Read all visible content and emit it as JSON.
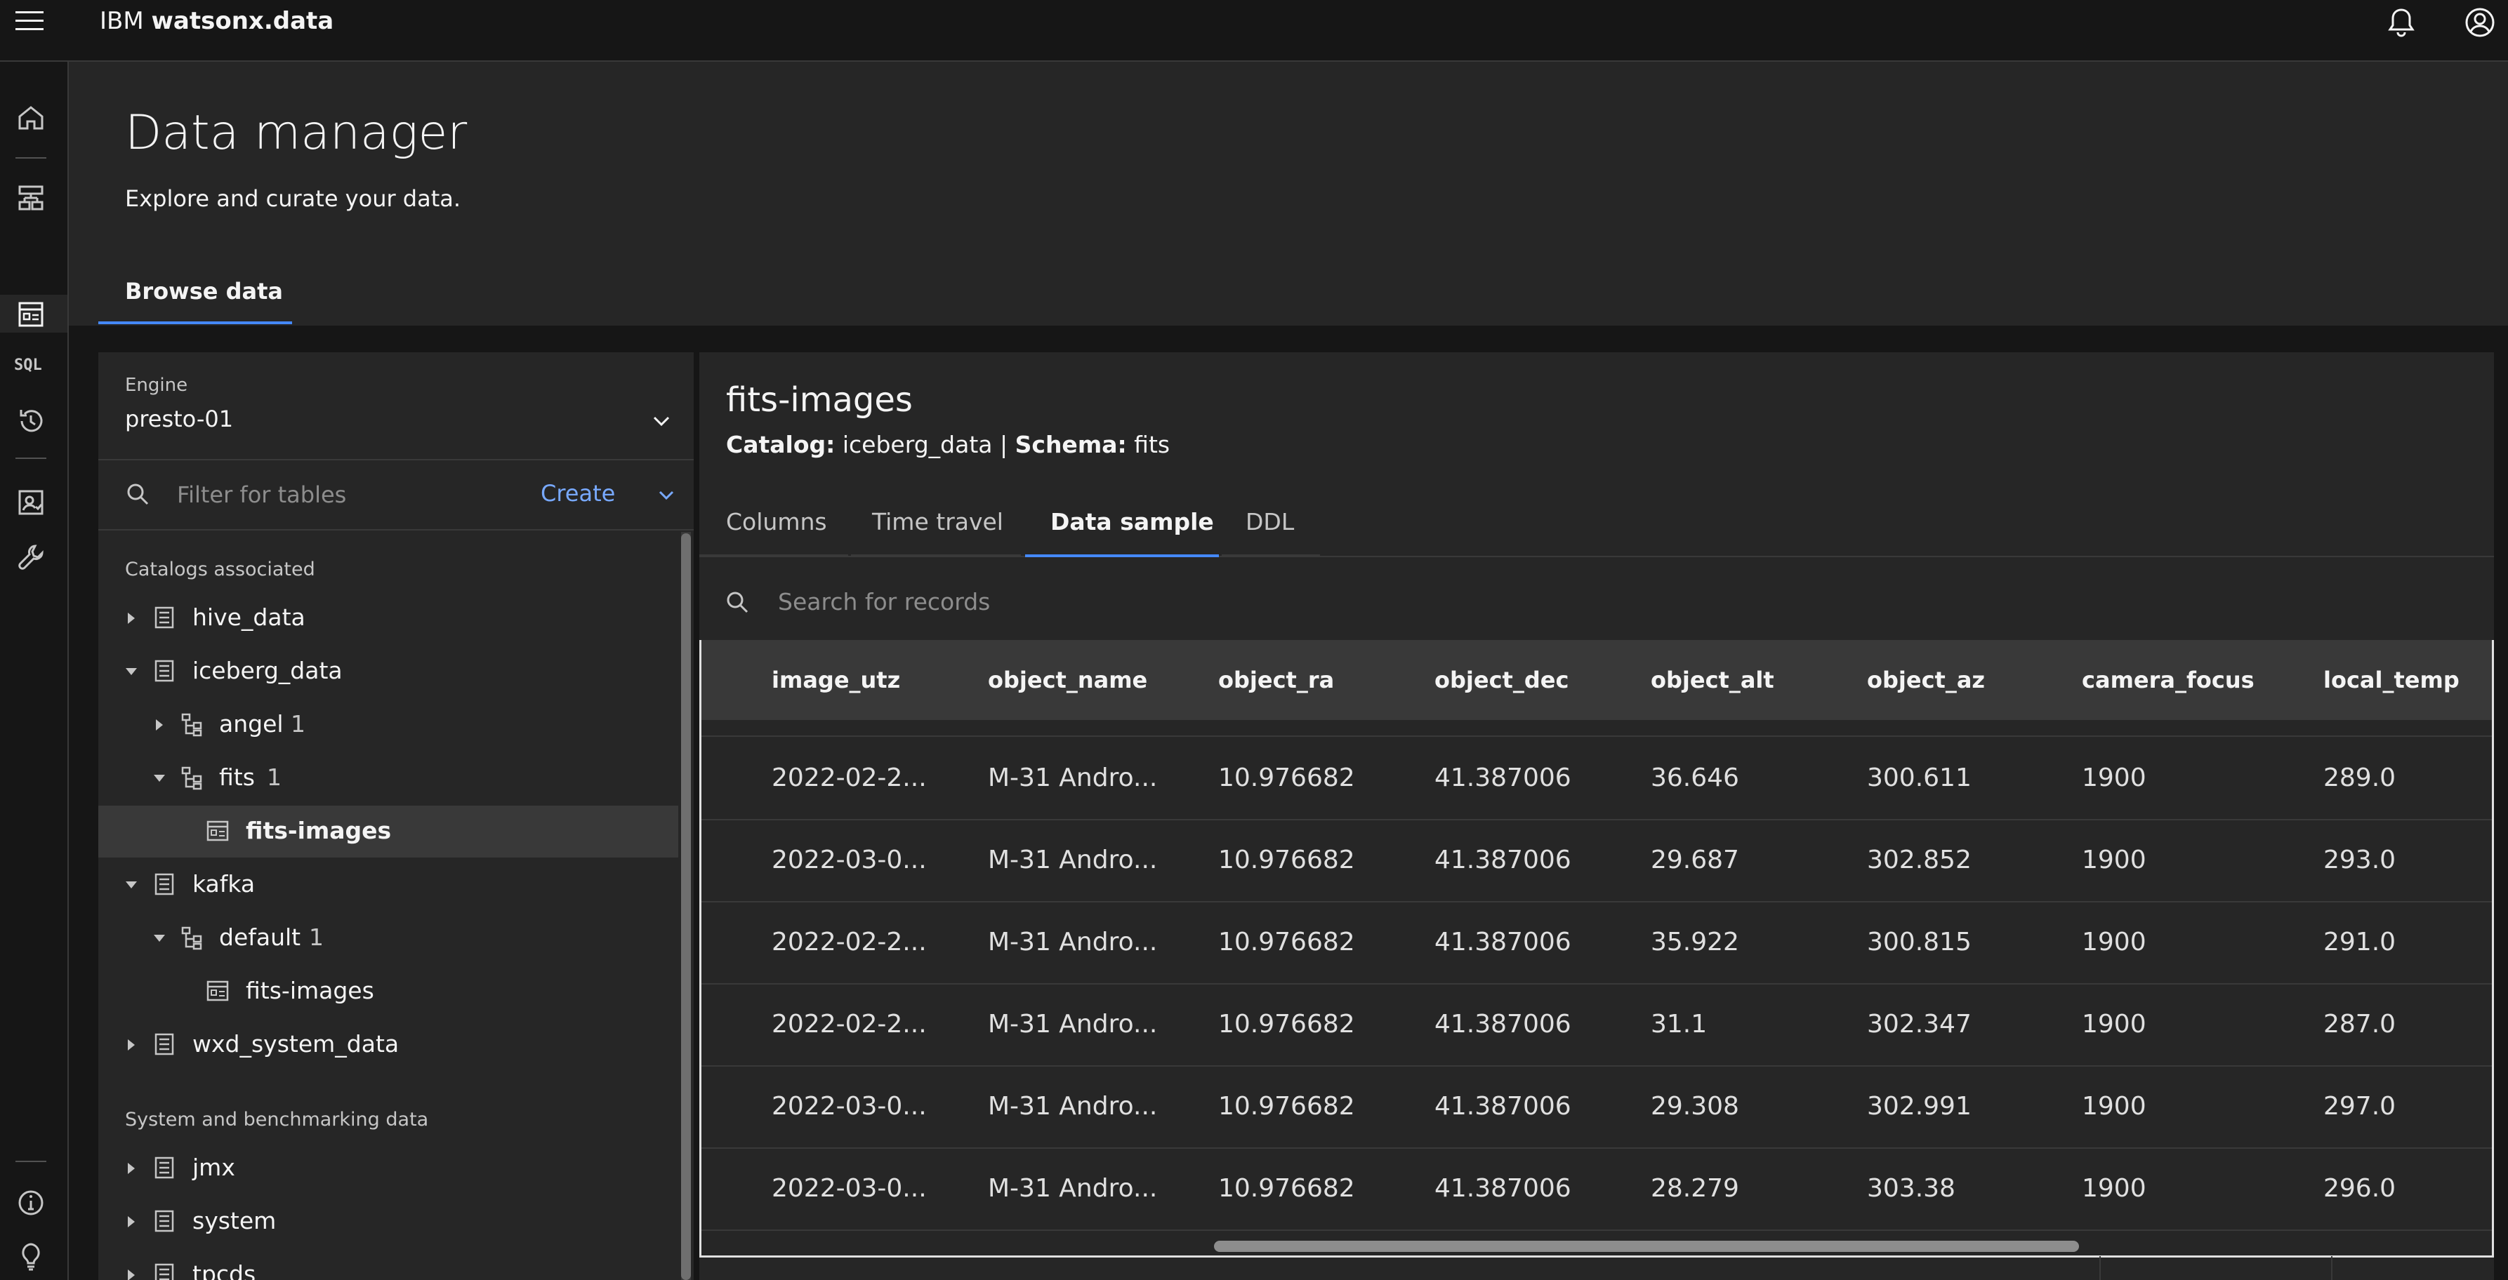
{
  "header": {
    "brand_prefix": "IBM",
    "brand_product": "watsonx.data",
    "notification_icon": "bell-icon",
    "user_icon": "user-avatar-icon"
  },
  "rail": {
    "items": [
      {
        "icon": "home-icon"
      },
      {
        "icon": "infrastructure-icon"
      },
      {
        "icon": "data-manager-icon",
        "active": true
      },
      {
        "icon": "sql-icon",
        "label": "SQL"
      },
      {
        "icon": "query-history-icon"
      },
      {
        "icon": "access-control-icon"
      },
      {
        "icon": "configurations-icon"
      },
      {
        "icon": "info-icon"
      },
      {
        "icon": "lightbulb-icon"
      }
    ]
  },
  "page": {
    "title": "Data manager",
    "subtitle": "Explore and curate your data.",
    "tab": "Browse data"
  },
  "left": {
    "engine_label": "Engine",
    "engine_value": "presto-01",
    "filter_placeholder": "Filter for tables",
    "create_label": "Create",
    "catalogs_label": "Catalogs associated",
    "system_label": "System and benchmarking data",
    "tree": [
      {
        "label": "hive_data",
        "expanded": false
      },
      {
        "label": "iceberg_data",
        "expanded": true
      },
      {
        "label": "angel",
        "count": "1",
        "expanded": false
      },
      {
        "label": "fits",
        "count": "1",
        "expanded": true
      },
      {
        "label": "fits-images",
        "selected": true
      },
      {
        "label": "kafka",
        "expanded": true
      },
      {
        "label": "default",
        "count": "1",
        "expanded": true
      },
      {
        "label": "fits-images"
      },
      {
        "label": "wxd_system_data",
        "expanded": false
      }
    ],
    "system_tree": [
      {
        "label": "jmx"
      },
      {
        "label": "system"
      },
      {
        "label": "tpcds"
      }
    ]
  },
  "right": {
    "table_name": "fits-images",
    "catalog_label": "Catalog:",
    "catalog_value": "iceberg_data",
    "separator": "|",
    "schema_label": "Schema:",
    "schema_value": "fits",
    "tabs": [
      "Columns",
      "Time travel",
      "Data sample",
      "DDL"
    ],
    "active_tab": "Data sample",
    "search_placeholder": "Search for records",
    "columns": [
      "image_utz",
      "object_name",
      "object_ra",
      "object_dec",
      "object_alt",
      "object_az",
      "camera_focus",
      "local_temp"
    ],
    "rows": [
      [
        "2022-02-2...",
        "M-31 Andro...",
        "10.976682",
        "41.387006",
        "36.646",
        "300.611",
        "1900",
        "289.0"
      ],
      [
        "2022-03-0...",
        "M-31 Andro...",
        "10.976682",
        "41.387006",
        "29.687",
        "302.852",
        "1900",
        "293.0"
      ],
      [
        "2022-02-2...",
        "M-31 Andro...",
        "10.976682",
        "41.387006",
        "35.922",
        "300.815",
        "1900",
        "291.0"
      ],
      [
        "2022-02-2...",
        "M-31 Andro...",
        "10.976682",
        "41.387006",
        "31.1",
        "302.347",
        "1900",
        "287.0"
      ],
      [
        "2022-03-0...",
        "M-31 Andro...",
        "10.976682",
        "41.387006",
        "29.308",
        "302.991",
        "1900",
        "297.0"
      ],
      [
        "2022-03-0...",
        "M-31 Andro...",
        "10.976682",
        "41.387006",
        "28.279",
        "303.38",
        "1900",
        "296.0"
      ]
    ]
  }
}
